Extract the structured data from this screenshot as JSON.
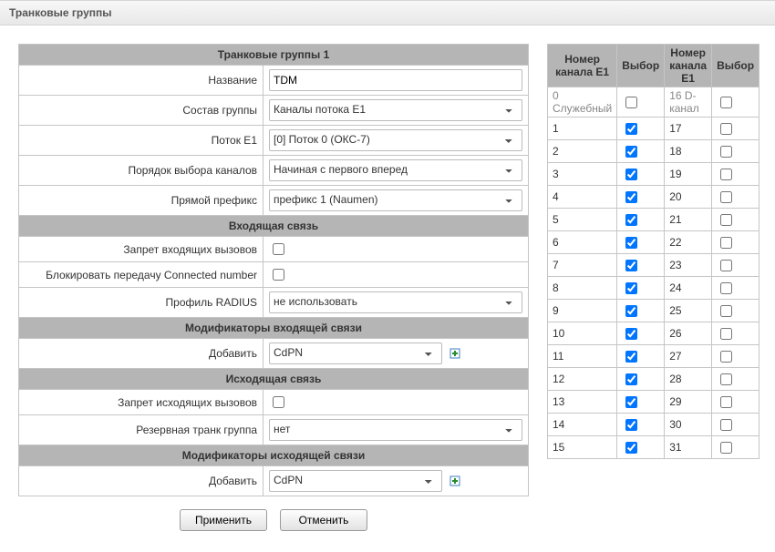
{
  "page_title": "Транковые группы",
  "form": {
    "header": "Транковые группы 1",
    "fields": {
      "name_label": "Название",
      "name_value": "TDM",
      "group_label": "Состав группы",
      "group_value": "Каналы потока E1",
      "stream_label": "Поток E1",
      "stream_value": "[0] Поток 0 (ОКС-7)",
      "order_label": "Порядок выбора каналов",
      "order_value": "Начиная с первого вперед",
      "prefix_label": "Прямой префикс",
      "prefix_value": "префикс 1 (Naumen)"
    },
    "incoming": {
      "header": "Входящая связь",
      "deny_in_label": "Запрет входящих вызовов",
      "deny_in": false,
      "block_conn_label": "Блокировать передачу Connected number",
      "block_conn": false,
      "radius_label": "Профиль RADIUS",
      "radius_value": "не использовать"
    },
    "in_mods": {
      "header": "Модификаторы входящей связи",
      "add_label": "Добавить",
      "add_value": "CdPN"
    },
    "outgoing": {
      "header": "Исходящая связь",
      "deny_out_label": "Запрет исходящих вызовов",
      "deny_out": false,
      "reserve_label": "Резервная транк группа",
      "reserve_value": "нет"
    },
    "out_mods": {
      "header": "Модификаторы исходящей связи",
      "add_label": "Добавить",
      "add_value": "CdPN"
    }
  },
  "buttons": {
    "apply": "Применить",
    "cancel": "Отменить"
  },
  "channel_table": {
    "col_num": "Номер канала E1",
    "col_sel": "Выбор",
    "left": [
      {
        "num": "0 Служебный",
        "sel": false,
        "disabled": true
      },
      {
        "num": "1",
        "sel": true
      },
      {
        "num": "2",
        "sel": true
      },
      {
        "num": "3",
        "sel": true
      },
      {
        "num": "4",
        "sel": true
      },
      {
        "num": "5",
        "sel": true
      },
      {
        "num": "6",
        "sel": true
      },
      {
        "num": "7",
        "sel": true
      },
      {
        "num": "8",
        "sel": true
      },
      {
        "num": "9",
        "sel": true
      },
      {
        "num": "10",
        "sel": true
      },
      {
        "num": "11",
        "sel": true
      },
      {
        "num": "12",
        "sel": true
      },
      {
        "num": "13",
        "sel": true
      },
      {
        "num": "14",
        "sel": true
      },
      {
        "num": "15",
        "sel": true
      }
    ],
    "right": [
      {
        "num": "16 D-канал",
        "sel": false,
        "disabled": true
      },
      {
        "num": "17",
        "sel": false
      },
      {
        "num": "18",
        "sel": false
      },
      {
        "num": "19",
        "sel": false
      },
      {
        "num": "20",
        "sel": false
      },
      {
        "num": "21",
        "sel": false
      },
      {
        "num": "22",
        "sel": false
      },
      {
        "num": "23",
        "sel": false
      },
      {
        "num": "24",
        "sel": false
      },
      {
        "num": "25",
        "sel": false
      },
      {
        "num": "26",
        "sel": false
      },
      {
        "num": "27",
        "sel": false
      },
      {
        "num": "28",
        "sel": false
      },
      {
        "num": "29",
        "sel": false
      },
      {
        "num": "30",
        "sel": false
      },
      {
        "num": "31",
        "sel": false
      }
    ]
  }
}
